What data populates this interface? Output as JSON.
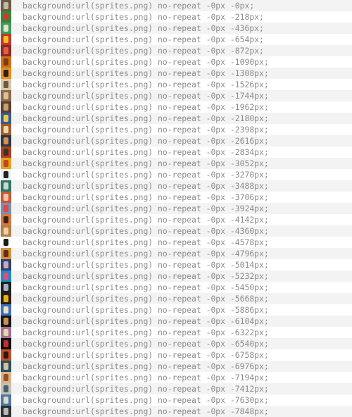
{
  "rows": [
    {
      "code": "background:url(sprites.png) no-repeat -0px -0px;",
      "thumb": "album-art-thumbnail",
      "c1": "#6b5a48",
      "c2": "#c8b89c"
    },
    {
      "code": "background:url(sprites.png) no-repeat -0px -218px;",
      "thumb": "album-art-thumbnail",
      "c1": "#2e8b3a",
      "c2": "#d8342c"
    },
    {
      "code": "background:url(sprites.png) no-repeat -0px -436px;",
      "thumb": "album-art-thumbnail",
      "c1": "#3c9a5a",
      "c2": "#e8e0c8"
    },
    {
      "code": "background:url(sprites.png) no-repeat -0px -654px;",
      "thumb": "album-art-thumbnail",
      "c1": "#c03828",
      "c2": "#f0c020"
    },
    {
      "code": "background:url(sprites.png) no-repeat -0px -872px;",
      "thumb": "album-art-thumbnail",
      "c1": "#8a2a2a",
      "c2": "#e06040"
    },
    {
      "code": "background:url(sprites.png) no-repeat -0px -1090px;",
      "thumb": "album-art-thumbnail",
      "c1": "#d07018",
      "c2": "#7a3c10"
    },
    {
      "code": "background:url(sprites.png) no-repeat -0px -1308px;",
      "thumb": "album-art-thumbnail",
      "c1": "#e89020",
      "c2": "#2a2018"
    },
    {
      "code": "background:url(sprites.png) no-repeat -0px -1526px;",
      "thumb": "album-art-thumbnail",
      "c1": "#d8c8a8",
      "c2": "#705840"
    },
    {
      "code": "background:url(sprites.png) no-repeat -0px -1744px;",
      "thumb": "album-art-thumbnail",
      "c1": "#8a6a4a",
      "c2": "#e0c090"
    },
    {
      "code": "background:url(sprites.png) no-repeat -0px -1962px;",
      "thumb": "album-art-thumbnail",
      "c1": "#5a4030",
      "c2": "#c8a070"
    },
    {
      "code": "background:url(sprites.png) no-repeat -0px -2180px;",
      "thumb": "album-art-thumbnail",
      "c1": "#3a5a8a",
      "c2": "#e8c858"
    },
    {
      "code": "background:url(sprites.png) no-repeat -0px -2398px;",
      "thumb": "album-art-thumbnail",
      "c1": "#a05a30",
      "c2": "#f0d8a0"
    },
    {
      "code": "background:url(sprites.png) no-repeat -0px -2616px;",
      "thumb": "album-art-thumbnail",
      "c1": "#283848",
      "c2": "#d89050"
    },
    {
      "code": "background:url(sprites.png) no-repeat -0px -2834px;",
      "thumb": "album-art-thumbnail",
      "c1": "#b04020",
      "c2": "#403028"
    },
    {
      "code": "background:url(sprites.png) no-repeat -0px -3052px;",
      "thumb": "album-art-thumbnail",
      "c1": "#e8a020",
      "c2": "#c04818"
    },
    {
      "code": "background:url(sprites.png) no-repeat -0px -3270px;",
      "thumb": "album-art-thumbnail",
      "c1": "#f0f0f0",
      "c2": "#202020"
    },
    {
      "code": "background:url(sprites.png) no-repeat -0px -3488px;",
      "thumb": "album-art-thumbnail",
      "c1": "#287868",
      "c2": "#d0d8c8"
    },
    {
      "code": "background:url(sprites.png) no-repeat -0px -3706px;",
      "thumb": "album-art-thumbnail",
      "c1": "#c85838",
      "c2": "#f0c8a0"
    },
    {
      "code": "background:url(sprites.png) no-repeat -0px -3924px;",
      "thumb": "album-art-thumbnail",
      "c1": "#7890b0",
      "c2": "#e04848"
    },
    {
      "code": "background:url(sprites.png) no-repeat -0px -4142px;",
      "thumb": "album-art-thumbnail",
      "c1": "#d87840",
      "c2": "#402018"
    },
    {
      "code": "background:url(sprites.png) no-repeat -0px -4360px;",
      "thumb": "album-art-thumbnail",
      "c1": "#b08048",
      "c2": "#f0d0a0"
    },
    {
      "code": "background:url(sprites.png) no-repeat -0px -4578px;",
      "thumb": "album-art-thumbnail",
      "c1": "#ffffff",
      "c2": "#1a1a1a"
    },
    {
      "code": "background:url(sprites.png) no-repeat -0px -4796px;",
      "thumb": "album-art-thumbnail",
      "c1": "#d89040",
      "c2": "#603018"
    },
    {
      "code": "background:url(sprites.png) no-repeat -0px -5014px;",
      "thumb": "album-art-thumbnail",
      "c1": "#304070",
      "c2": "#c8a8c0"
    },
    {
      "code": "background:url(sprites.png) no-repeat -0px -5232px;",
      "thumb": "album-art-thumbnail",
      "c1": "#2088c8",
      "c2": "#e05070"
    },
    {
      "code": "background:url(sprites.png) no-repeat -0px -5450px;",
      "thumb": "album-art-thumbnail",
      "c1": "#182028",
      "c2": "#a8b0b8"
    },
    {
      "code": "background:url(sprites.png) no-repeat -0px -5668px;",
      "thumb": "album-art-thumbnail",
      "c1": "#2a2010",
      "c2": "#e8b020"
    },
    {
      "code": "background:url(sprites.png) no-repeat -0px -5886px;",
      "thumb": "album-art-thumbnail",
      "c1": "#3870c0",
      "c2": "#f0e0c0"
    },
    {
      "code": "background:url(sprites.png) no-repeat -0px -6104px;",
      "thumb": "album-art-thumbnail",
      "c1": "#181818",
      "c2": "#c89058"
    },
    {
      "code": "background:url(sprites.png) no-repeat -0px -6322px;",
      "thumb": "album-art-thumbnail",
      "c1": "#a07090",
      "c2": "#e8d0b0"
    },
    {
      "code": "background:url(sprites.png) no-repeat -0px -6540px;",
      "thumb": "album-art-thumbnail",
      "c1": "#101010",
      "c2": "#c03030"
    },
    {
      "code": "background:url(sprites.png) no-repeat -0px -6758px;",
      "thumb": "album-art-thumbnail",
      "c1": "#c05028",
      "c2": "#301810"
    },
    {
      "code": "background:url(sprites.png) no-repeat -0px -6976px;",
      "thumb": "album-art-thumbnail",
      "c1": "#285060",
      "c2": "#d8c0a0"
    },
    {
      "code": "background:url(sprites.png) no-repeat -0px -7194px;",
      "thumb": "album-art-thumbnail",
      "c1": "#e0b080",
      "c2": "#905030"
    },
    {
      "code": "background:url(sprites.png) no-repeat -0px -7412px;",
      "thumb": "album-art-thumbnail",
      "c1": "#c8c0b0",
      "c2": "#486070"
    },
    {
      "code": "background:url(sprites.png) no-repeat -0px -7630px;",
      "thumb": "album-art-thumbnail",
      "c1": "#4878a8",
      "c2": "#e0d8c0"
    },
    {
      "code": "background:url(sprites.png) no-repeat -0px -7848px;",
      "thumb": "album-art-thumbnail",
      "c1": "#303030",
      "c2": "#b8b8b8"
    }
  ]
}
